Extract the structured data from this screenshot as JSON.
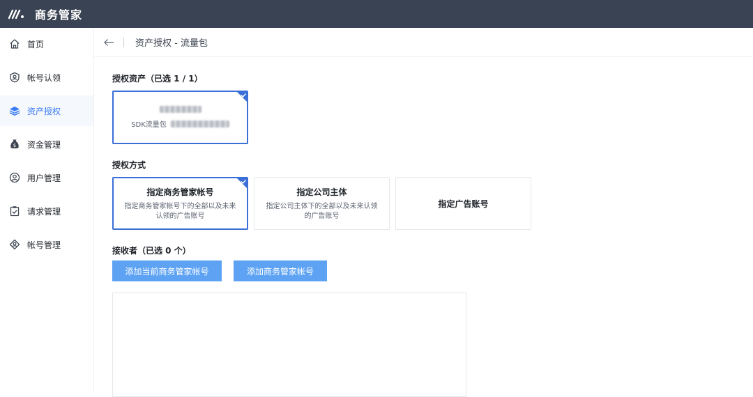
{
  "app": {
    "title": "商务管家"
  },
  "sidebar": {
    "items": [
      {
        "label": "首页",
        "icon": "home-icon"
      },
      {
        "label": "帐号认领",
        "icon": "account-claim-icon"
      },
      {
        "label": "资产授权",
        "icon": "layers-icon",
        "active": true
      },
      {
        "label": "资金管理",
        "icon": "money-bag-icon"
      },
      {
        "label": "用户管理",
        "icon": "user-icon"
      },
      {
        "label": "请求管理",
        "icon": "clipboard-check-icon"
      },
      {
        "label": "帐号管理",
        "icon": "account-manage-icon"
      }
    ]
  },
  "header": {
    "title": "资产授权 - 流量包"
  },
  "assets": {
    "label": "授权资产（已选 1 / 1）",
    "card": {
      "subtitle_prefix": "SDK流量包"
    }
  },
  "methods": {
    "label": "授权方式",
    "options": [
      {
        "title": "指定商务管家帐号",
        "desc": "指定商务管家帐号下的全部以及未来认领的广告账号",
        "selected": true
      },
      {
        "title": "指定公司主体",
        "desc": "指定公司主体下的全部以及未来认领的广告账号",
        "selected": false
      },
      {
        "title": "指定广告账号",
        "desc": "",
        "selected": false
      }
    ]
  },
  "receivers": {
    "label": "接收者（已选 0 个）",
    "add_current_label": "添加当前商务管家帐号",
    "add_label": "添加商务管家帐号"
  },
  "colors": {
    "accent": "#3a6fd8",
    "button": "#5ea3f3",
    "topbar": "#3a4353",
    "active_text": "#3a7bf4"
  }
}
